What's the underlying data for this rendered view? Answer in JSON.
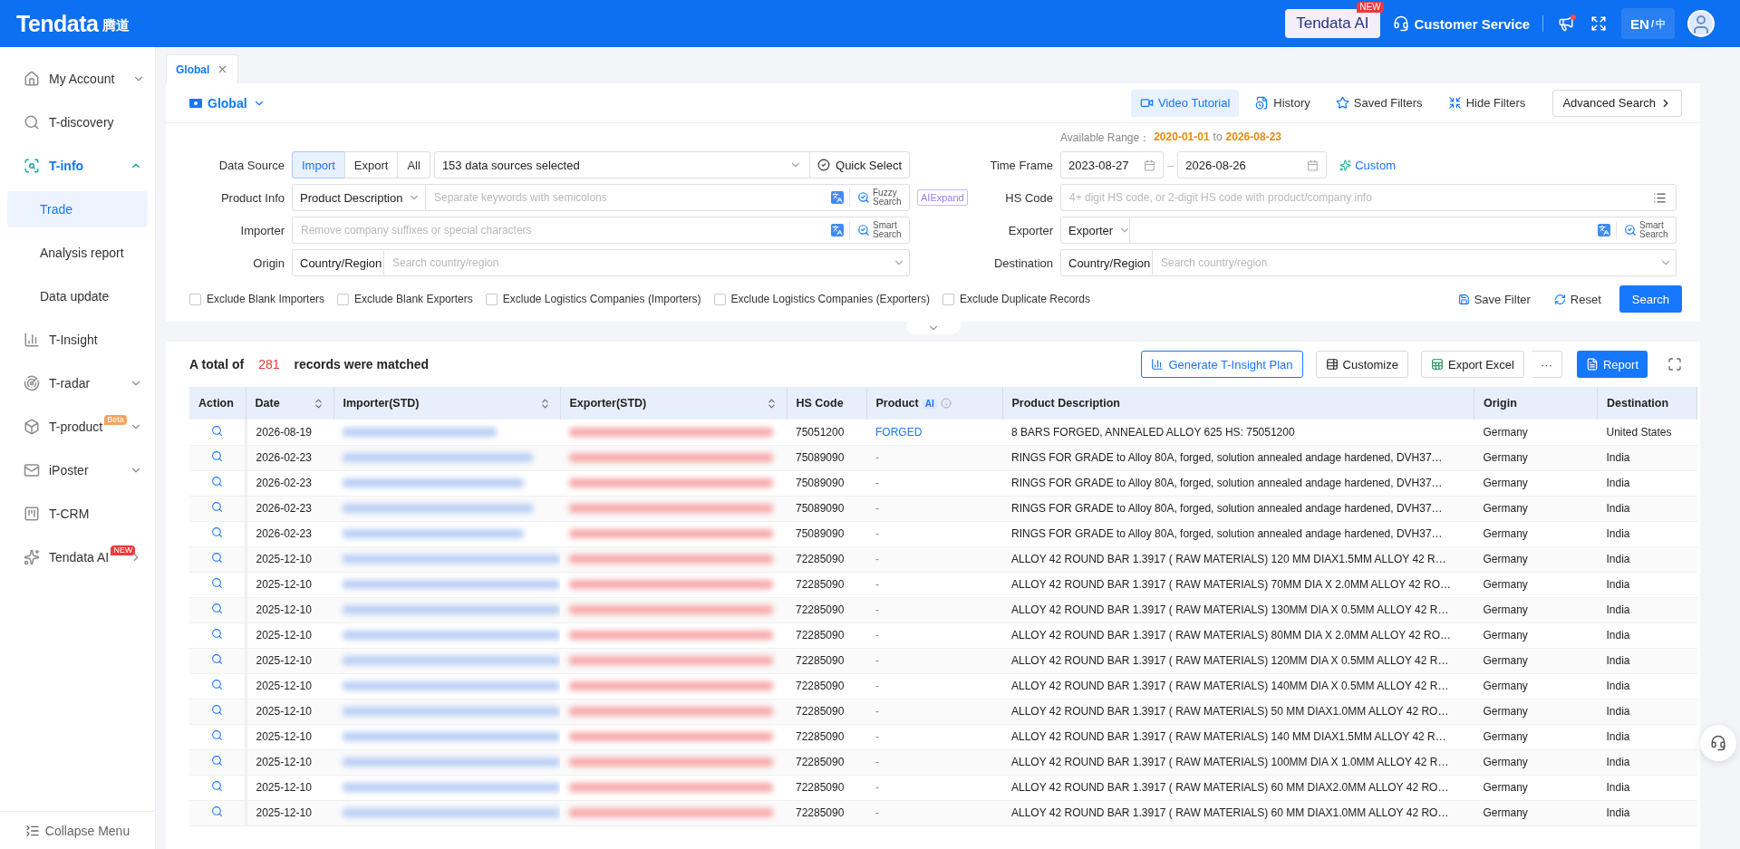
{
  "header": {
    "logo": {
      "name": "Tendata",
      "cn": "腾道"
    },
    "ai_button": {
      "label": "Tendata AI",
      "badge": "NEW"
    },
    "service": "Customer Service",
    "notification_dot": true,
    "language": {
      "separator": "/",
      "options": [
        {
          "label": "EN",
          "selected": true
        },
        {
          "label": "中",
          "selected": false
        }
      ]
    }
  },
  "sidebar": {
    "items": [
      {
        "label": "My Account",
        "kind": "group",
        "expanded": false,
        "selected": false
      },
      {
        "label": "T-discovery",
        "kind": "plain",
        "selected": false
      },
      {
        "label": "T-info",
        "kind": "group",
        "expanded": true,
        "selected": true,
        "children": [
          {
            "label": "Trade",
            "selected": true
          },
          {
            "label": "Analysis report",
            "selected": false
          },
          {
            "label": "Data update",
            "selected": false
          }
        ]
      },
      {
        "label": "T-Insight",
        "kind": "plain",
        "selected": false
      },
      {
        "label": "T-radar",
        "kind": "group",
        "expanded": false,
        "selected": false
      },
      {
        "label": "T-product",
        "kind": "group",
        "expanded": false,
        "selected": false,
        "badge": {
          "text": "Beta",
          "color": "#f5a25d"
        }
      },
      {
        "label": "iPoster",
        "kind": "group",
        "expanded": false,
        "selected": false
      },
      {
        "label": "T-CRM",
        "kind": "plain",
        "selected": false
      },
      {
        "label": "Tendata AI",
        "kind": "flyout",
        "selected": false,
        "badge": {
          "text": "NEW",
          "color": "#f0393d"
        }
      }
    ],
    "collapse": "Collapse Menu"
  },
  "page_tabs": [
    {
      "label": "Global",
      "selected": true
    }
  ],
  "scope": "Global",
  "toolbar": [
    {
      "label": "Video Tutorial",
      "selected": true
    },
    {
      "label": "History",
      "selected": false
    },
    {
      "label": "Saved Filters",
      "selected": false
    },
    {
      "label": "Hide Filters",
      "selected": false
    }
  ],
  "advanced_search": "Advanced Search",
  "available_range": {
    "label": "Available Range：",
    "from": "2020-01-01",
    "to_word": "to",
    "to": "2026-08-23"
  },
  "filters": {
    "data_source": {
      "label": "Data Source",
      "modes": [
        {
          "label": "Import",
          "selected": true
        },
        {
          "label": "Export",
          "selected": false
        },
        {
          "label": "All",
          "selected": false
        }
      ],
      "sources": "153 data sources selected",
      "quick_select": "Quick Select"
    },
    "product_info": {
      "label": "Product Info",
      "field": "Product Description",
      "placeholder": "Separate keywords with semicolons",
      "search_button": "Fuzzy Search",
      "ai_expand": "AIExpand"
    },
    "importer": {
      "label": "Importer",
      "placeholder": "Remove company suffixes or special characters",
      "search_button": "Smart Search"
    },
    "origin": {
      "label": "Origin",
      "field": "Country/Region",
      "placeholder": "Search country/region"
    },
    "time_frame": {
      "label": "Time Frame",
      "start": "2023-08-27",
      "separator": "–",
      "end": "2026-08-26",
      "custom": "Custom"
    },
    "hs_code": {
      "label": "HS Code",
      "placeholder": "4+ digit HS code, or 2-digit HS code with product/company info"
    },
    "exporter": {
      "label": "Exporter",
      "field": "Exporter",
      "search_button": "Smart Search"
    },
    "destination": {
      "label": "Destination",
      "field": "Country/Region",
      "placeholder": "Search country/region"
    }
  },
  "checkboxes": [
    {
      "label": "Exclude Blank Importers",
      "checked": false
    },
    {
      "label": "Exclude Blank Exporters",
      "checked": false
    },
    {
      "label": "Exclude Logistics Companies (Importers)",
      "checked": false
    },
    {
      "label": "Exclude Logistics Companies (Exporters)",
      "checked": false
    },
    {
      "label": "Exclude Duplicate Records",
      "checked": false
    }
  ],
  "filter_actions": {
    "save": "Save Filter",
    "reset": "Reset",
    "search": "Search"
  },
  "results": {
    "before": "A total of",
    "count": "281",
    "after": "records were matched"
  },
  "result_actions": [
    {
      "label": "Generate T-Insight Plan",
      "kind": "outline"
    },
    {
      "label": "Customize",
      "kind": "default"
    },
    {
      "label": "Export Excel",
      "kind": "excel"
    },
    {
      "label": "···",
      "kind": "more"
    },
    {
      "label": "Report",
      "kind": "primary"
    }
  ],
  "table": {
    "columns": [
      {
        "label": "Action",
        "sortable": false
      },
      {
        "label": "Date",
        "sortable": true
      },
      {
        "label": "Importer(STD)",
        "sortable": true
      },
      {
        "label": "Exporter(STD)",
        "sortable": true
      },
      {
        "label": "HS Code",
        "sortable": false
      },
      {
        "label": "Product",
        "sortable": false,
        "badge": "AI"
      },
      {
        "label": "Product Description",
        "sortable": false
      },
      {
        "label": "Origin",
        "sortable": false
      },
      {
        "label": "Destination",
        "sortable": false
      }
    ],
    "rows": [
      {
        "date": "2026-08-19",
        "hs_code": "75051200",
        "product": "FORGED",
        "product_link": true,
        "description": "8 BARS FORGED, ANNEALED ALLOY 625 HS: 75051200",
        "origin": "Germany",
        "destination": "United States"
      },
      {
        "date": "2026-02-23",
        "hs_code": "75089090",
        "product": "-",
        "product_link": false,
        "description": "RINGS FOR GRADE to Alloy 80A, forged, solution annealed andage hardened, DVH37…",
        "origin": "Germany",
        "destination": "India"
      },
      {
        "date": "2026-02-23",
        "hs_code": "75089090",
        "product": "-",
        "product_link": false,
        "description": "RINGS FOR GRADE to Alloy 80A, forged, solution annealed andage hardened, DVH37…",
        "origin": "Germany",
        "destination": "India"
      },
      {
        "date": "2026-02-23",
        "hs_code": "75089090",
        "product": "-",
        "product_link": false,
        "description": "RINGS FOR GRADE to Alloy 80A, forged, solution annealed andage hardened, DVH37…",
        "origin": "Germany",
        "destination": "India"
      },
      {
        "date": "2026-02-23",
        "hs_code": "75089090",
        "product": "-",
        "product_link": false,
        "description": "RINGS FOR GRADE to Alloy 80A, forged, solution annealed andage hardened, DVH37…",
        "origin": "Germany",
        "destination": "India"
      },
      {
        "date": "2025-12-10",
        "hs_code": "72285090",
        "product": "-",
        "product_link": false,
        "description": "ALLOY 42 ROUND BAR 1.3917 ( RAW MATERIALS) 120 MM DIAX1.5MM ALLOY 42 R…",
        "origin": "Germany",
        "destination": "India"
      },
      {
        "date": "2025-12-10",
        "hs_code": "72285090",
        "product": "-",
        "product_link": false,
        "description": "ALLOY 42 ROUND BAR 1.3917 ( RAW MATERIALS) 70MM DIA X 2.0MM ALLOY 42 RO…",
        "origin": "Germany",
        "destination": "India"
      },
      {
        "date": "2025-12-10",
        "hs_code": "72285090",
        "product": "-",
        "product_link": false,
        "description": "ALLOY 42 ROUND BAR 1.3917 ( RAW MATERIALS) 130MM DIA X 0.5MM ALLOY 42 R…",
        "origin": "Germany",
        "destination": "India"
      },
      {
        "date": "2025-12-10",
        "hs_code": "72285090",
        "product": "-",
        "product_link": false,
        "description": "ALLOY 42 ROUND BAR 1.3917 ( RAW MATERIALS) 80MM DIA X 2.0MM ALLOY 42 RO…",
        "origin": "Germany",
        "destination": "India"
      },
      {
        "date": "2025-12-10",
        "hs_code": "72285090",
        "product": "-",
        "product_link": false,
        "description": "ALLOY 42 ROUND BAR 1.3917 ( RAW MATERIALS) 120MM DIA X 0.5MM ALLOY 42 R…",
        "origin": "Germany",
        "destination": "India"
      },
      {
        "date": "2025-12-10",
        "hs_code": "72285090",
        "product": "-",
        "product_link": false,
        "description": "ALLOY 42 ROUND BAR 1.3917 ( RAW MATERIALS) 140MM DIA X 0.5MM ALLOY 42 R…",
        "origin": "Germany",
        "destination": "India"
      },
      {
        "date": "2025-12-10",
        "hs_code": "72285090",
        "product": "-",
        "product_link": false,
        "description": "ALLOY 42 ROUND BAR 1.3917 ( RAW MATERIALS) 50 MM DIAX1.0MM ALLOY 42 RO…",
        "origin": "Germany",
        "destination": "India"
      },
      {
        "date": "2025-12-10",
        "hs_code": "72285090",
        "product": "-",
        "product_link": false,
        "description": "ALLOY 42 ROUND BAR 1.3917 ( RAW MATERIALS) 140 MM DIAX1.5MM ALLOY 42 R…",
        "origin": "Germany",
        "destination": "India"
      },
      {
        "date": "2025-12-10",
        "hs_code": "72285090",
        "product": "-",
        "product_link": false,
        "description": "ALLOY 42 ROUND BAR 1.3917 ( RAW MATERIALS) 100MM DIA X 1.0MM ALLOY 42 R…",
        "origin": "Germany",
        "destination": "India"
      },
      {
        "date": "2025-12-10",
        "hs_code": "72285090",
        "product": "-",
        "product_link": false,
        "description": "ALLOY 42 ROUND BAR 1.3917 ( RAW MATERIALS) 60 MM DIAX2.0MM ALLOY 42 RO…",
        "origin": "Germany",
        "destination": "India"
      },
      {
        "date": "2025-12-10",
        "hs_code": "72285090",
        "product": "-",
        "product_link": false,
        "description": "ALLOY 42 ROUND BAR 1.3917 ( RAW MATERIALS) 60 MM DIAX1.0MM ALLOY 42 RO…",
        "origin": "Germany",
        "destination": "India"
      }
    ]
  }
}
